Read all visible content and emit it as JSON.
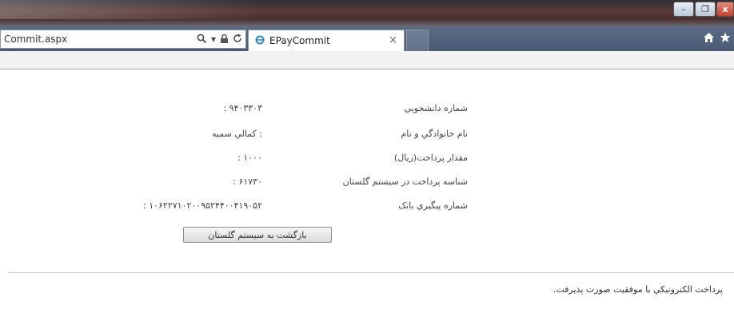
{
  "browser": {
    "url": "Commit.aspx",
    "tab_title": "EPayCommit",
    "tab_close": "×",
    "window_buttons": {
      "minimize": "–",
      "maximize": "❐",
      "close": "x"
    }
  },
  "receipt": {
    "rows": [
      {
        "label": "شماره دانشجويي",
        "value": "۹۴۰۳۳۰۳ :"
      },
      {
        "label": "نام خانوادگي و نام",
        "value": ": کمالي سميه"
      },
      {
        "label": "مقدار پرداخت(ريال)",
        "value": "۱۰۰۰ :"
      },
      {
        "label": "شناسه پرداخت در سيستم گلستان",
        "value": "۶۱۷۳۰ :"
      },
      {
        "label": "شماره پيگيري بانک",
        "value": "۱۰۶۲۲۷۱۰۲۰۰۹۵۲۴۴۰۰۴۱۹۰۵۲ :"
      }
    ],
    "back_button_label": "بازگشت به سيستم گلستان"
  },
  "status_message": "پرداخت الکترونيکي با موفقيت صورت پذيرفت.",
  "icons": {
    "search": "search-icon",
    "lock": "lock-icon",
    "refresh": "refresh-icon",
    "home": "home-icon",
    "favorites": "star-icon",
    "tab_favicon": "ie-page-icon"
  }
}
